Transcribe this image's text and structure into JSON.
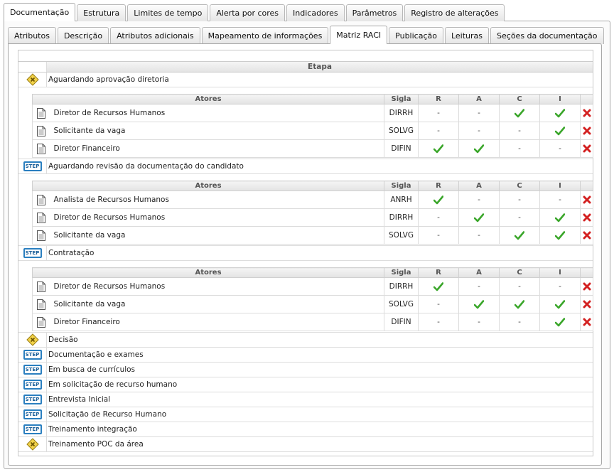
{
  "tabs_top": [
    "Documentação",
    "Estrutura",
    "Limites de tempo",
    "Alerta por cores",
    "Indicadores",
    "Parâmetros",
    "Registro de alterações"
  ],
  "tabs_sub": [
    "Atributos",
    "Descrição",
    "Atributos adicionais",
    "Mapeamento de informações",
    "Matriz RACI",
    "Publicação",
    "Leituras",
    "Seções da documentação"
  ],
  "active_top": 0,
  "active_sub": 4,
  "table": {
    "etapa_header": "Etapa",
    "actors_header": "Atores",
    "sigla_header": "Sigla",
    "raci_headers": [
      "R",
      "A",
      "C",
      "I"
    ],
    "empty_mark": "-"
  },
  "stages": [
    {
      "type": "decision",
      "name": "Aguardando aprovação diretoria",
      "actors": [
        {
          "name": "Diretor de Recursos Humanos",
          "sigla": "DIRRH",
          "raci": [
            false,
            false,
            true,
            true
          ]
        },
        {
          "name": "Solicitante da vaga",
          "sigla": "SOLVG",
          "raci": [
            false,
            false,
            false,
            true
          ]
        },
        {
          "name": "Diretor Financeiro",
          "sigla": "DIFIN",
          "raci": [
            true,
            true,
            false,
            false
          ]
        }
      ]
    },
    {
      "type": "step",
      "name": "Aguardando revisão da documentação do candidato",
      "actors": [
        {
          "name": "Analista de Recursos Humanos",
          "sigla": "ANRH",
          "raci": [
            true,
            false,
            false,
            false
          ]
        },
        {
          "name": "Diretor de Recursos Humanos",
          "sigla": "DIRRH",
          "raci": [
            false,
            true,
            false,
            true
          ]
        },
        {
          "name": "Solicitante da vaga",
          "sigla": "SOLVG",
          "raci": [
            false,
            false,
            true,
            true
          ]
        }
      ]
    },
    {
      "type": "step",
      "name": "Contratação",
      "actors": [
        {
          "name": "Diretor de Recursos Humanos",
          "sigla": "DIRRH",
          "raci": [
            true,
            false,
            false,
            false
          ]
        },
        {
          "name": "Solicitante da vaga",
          "sigla": "SOLVG",
          "raci": [
            false,
            true,
            true,
            true
          ]
        },
        {
          "name": "Diretor Financeiro",
          "sigla": "DIFIN",
          "raci": [
            false,
            false,
            false,
            true
          ]
        }
      ]
    },
    {
      "type": "decision",
      "name": "Decisão",
      "actors": []
    },
    {
      "type": "step",
      "name": "Documentação e exames",
      "actors": []
    },
    {
      "type": "step",
      "name": "Em busca de currículos",
      "actors": []
    },
    {
      "type": "step",
      "name": "Em solicitação de recurso humano",
      "actors": []
    },
    {
      "type": "step",
      "name": "Entrevista Inicial",
      "actors": []
    },
    {
      "type": "step",
      "name": "Solicitação de Recurso Humano",
      "actors": []
    },
    {
      "type": "step",
      "name": "Treinamento integração",
      "actors": []
    },
    {
      "type": "decision",
      "name": "Treinamento POC da área",
      "actors": []
    }
  ],
  "icons": {
    "step": "step-icon",
    "decision": "decision-icon",
    "document": "document-icon",
    "check": "check-icon",
    "remove": "remove-icon",
    "step_text": "STEP"
  },
  "colors": {
    "check": "#3aa62a",
    "remove": "#d32020",
    "step_border": "#2a7fc0",
    "decision_fill": "#f2d24a"
  }
}
